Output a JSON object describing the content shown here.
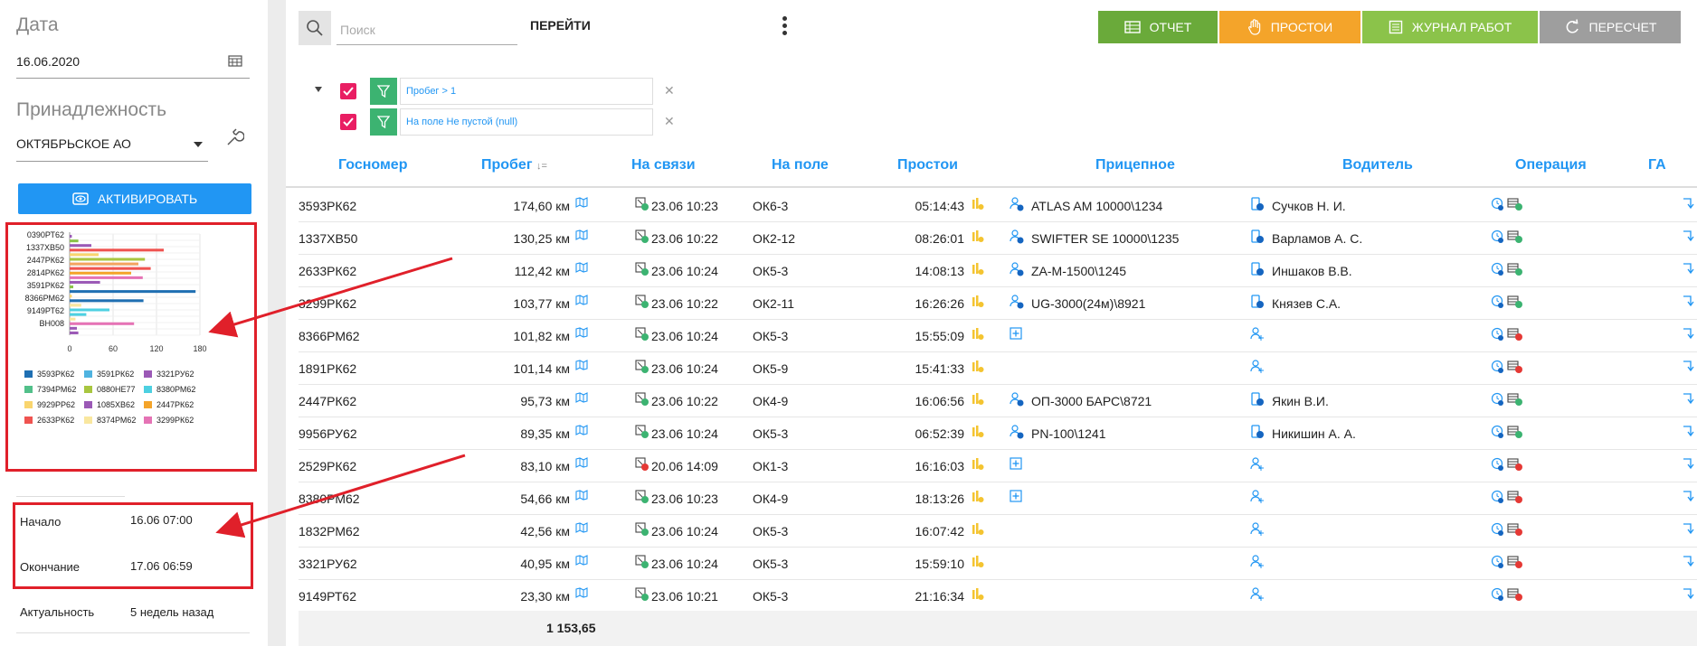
{
  "sidebar": {
    "date_label": "Дата",
    "date_value": "16.06.2020",
    "owner_label": "Принадлежность",
    "owner_value": "ОКТЯБРЬСКОЕ АО",
    "activate_label": "АКТИВИРОВАТЬ",
    "info": [
      {
        "label": "Начало",
        "value": "16.06 07:00"
      },
      {
        "label": "Окончание",
        "value": "17.06 06:59"
      },
      {
        "label": "Актуальность",
        "value": "5 недель назад"
      }
    ]
  },
  "toolbar": {
    "search_placeholder": "Поиск",
    "go_label": "ПЕРЕЙТИ",
    "buttons": [
      {
        "label": "ОТЧЕТ",
        "color": "#6aaa3a"
      },
      {
        "label": "ПРОСТОИ",
        "color": "#f4a42a"
      },
      {
        "label": "ЖУРНАЛ РАБОТ",
        "color": "#8bc34a"
      },
      {
        "label": "ПЕРЕСЧЕТ",
        "color": "#9e9e9e"
      }
    ]
  },
  "filters": [
    {
      "text": "Пробег > 1"
    },
    {
      "text": "На поле Не пустой (null)"
    }
  ],
  "table": {
    "columns": [
      "Госномер",
      "Пробег",
      "На связи",
      "На поле",
      "Простои",
      "Прицепное",
      "Водитель",
      "Операция",
      "ГА"
    ],
    "rows": [
      {
        "plate": "3593РК62",
        "mileage": "174,60 км",
        "online": "23.06 10:23",
        "field": "ОК6-3",
        "idle": "05:14:43",
        "trailer": "ATLAS AM 10000\\1234",
        "driver": "Сучков Н. И.",
        "online_ok": true,
        "op_ok": true
      },
      {
        "plate": "1337ХВ50",
        "mileage": "130,25 км",
        "online": "23.06 10:22",
        "field": "ОК2-12",
        "idle": "08:26:01",
        "trailer": "SWIFTER SE 10000\\1235",
        "driver": "Варламов А. С.",
        "online_ok": true,
        "op_ok": true
      },
      {
        "plate": "2633РК62",
        "mileage": "112,42 км",
        "online": "23.06 10:24",
        "field": "ОК5-3",
        "idle": "14:08:13",
        "trailer": "ZA-M-1500\\1245",
        "driver": "Иншаков В.В.",
        "online_ok": true,
        "op_ok": true
      },
      {
        "plate": "3299РК62",
        "mileage": "103,77 км",
        "online": "23.06 10:22",
        "field": "ОК2-11",
        "idle": "16:26:26",
        "trailer": "UG-3000(24м)\\8921",
        "driver": "Князев С.А.",
        "online_ok": true,
        "op_ok": true
      },
      {
        "plate": "8366РМ62",
        "mileage": "101,82 км",
        "online": "23.06 10:24",
        "field": "ОК5-3",
        "idle": "15:55:09",
        "trailer": "",
        "driver": "",
        "online_ok": true,
        "op_ok": false
      },
      {
        "plate": "1891РК62",
        "mileage": "101,14 км",
        "online": "23.06 10:24",
        "field": "ОК5-9",
        "idle": "15:41:33",
        "trailer": "",
        "driver": "",
        "online_ok": true,
        "op_ok": false
      },
      {
        "plate": "2447РК62",
        "mileage": "95,73 км",
        "online": "23.06 10:22",
        "field": "ОК4-9",
        "idle": "16:06:56",
        "trailer": "ОП-3000 БАРС\\8721",
        "driver": "Якин В.И.",
        "online_ok": true,
        "op_ok": true
      },
      {
        "plate": "9956РУ62",
        "mileage": "89,35 км",
        "online": "23.06 10:24",
        "field": "ОК5-3",
        "idle": "06:52:39",
        "trailer": "PN-100\\1241",
        "driver": "Никишин А. А.",
        "online_ok": true,
        "op_ok": true
      },
      {
        "plate": "2529РК62",
        "mileage": "83,10 км",
        "online": "20.06 14:09",
        "field": "ОК1-3",
        "idle": "16:16:03",
        "trailer": "",
        "driver": "",
        "online_ok": false,
        "op_ok": false
      },
      {
        "plate": "8380РМ62",
        "mileage": "54,66 км",
        "online": "23.06 10:23",
        "field": "ОК4-9",
        "idle": "18:13:26",
        "trailer": "",
        "driver": "",
        "online_ok": true,
        "op_ok": false
      },
      {
        "plate": "1832РМ62",
        "mileage": "42,56 км",
        "online": "23.06 10:24",
        "field": "ОК5-3",
        "idle": "16:07:42",
        "trailer": "",
        "driver": "",
        "online_ok": true,
        "op_ok": false
      },
      {
        "plate": "3321РУ62",
        "mileage": "40,95 км",
        "online": "23.06 10:24",
        "field": "ОК5-3",
        "idle": "15:59:10",
        "trailer": "",
        "driver": "",
        "online_ok": true,
        "op_ok": false
      },
      {
        "plate": "9149РТ62",
        "mileage": "23,30 км",
        "online": "23.06 10:21",
        "field": "ОК5-3",
        "idle": "21:16:34",
        "trailer": "",
        "driver": "",
        "online_ok": true,
        "op_ok": false
      }
    ],
    "total": "1 153,65"
  },
  "chart_data": {
    "type": "bar",
    "orientation": "horizontal",
    "category_labels": [
      "0390РТ62",
      "1337ХВ50",
      "2447РК62",
      "2814РК62",
      "3591РК62",
      "8366РМ62",
      "9149РТ62",
      "ВН008"
    ],
    "xticks": [
      0,
      60,
      120,
      180
    ],
    "xlim": [
      0,
      180
    ],
    "bars": [
      {
        "value": 3,
        "color": "#9b59b6"
      },
      {
        "value": 12,
        "color": "#8bc34a"
      },
      {
        "value": 30,
        "color": "#9b59b6"
      },
      {
        "value": 130,
        "color": "#ef5350"
      },
      {
        "value": 40,
        "color": "#f9d56e"
      },
      {
        "value": 104,
        "color": "#a8c640"
      },
      {
        "value": 95,
        "color": "#f4a460"
      },
      {
        "value": 112,
        "color": "#ef5350"
      },
      {
        "value": 85,
        "color": "#f4a42a"
      },
      {
        "value": 101,
        "color": "#e573b5"
      },
      {
        "value": 42,
        "color": "#9b59b6"
      },
      {
        "value": 5,
        "color": "#8bc34a"
      },
      {
        "value": 174,
        "color": "#1f6fb2"
      },
      {
        "value": 3,
        "color": "#f9d56e"
      },
      {
        "value": 102,
        "color": "#1f6fb2"
      },
      {
        "value": 16,
        "color": "#f9e79f"
      },
      {
        "value": 55,
        "color": "#4dd0e1"
      },
      {
        "value": 23,
        "color": "#4dd0e1"
      },
      {
        "value": 8,
        "color": "#f9e79f"
      },
      {
        "value": 89,
        "color": "#e573b5"
      },
      {
        "value": 10,
        "color": "#9b59b6"
      },
      {
        "value": 12,
        "color": "#9b59b6"
      }
    ],
    "legend": [
      {
        "name": "3593РК62",
        "color": "#1f6fb2"
      },
      {
        "name": "3591РК62",
        "color": "#4fb3e0"
      },
      {
        "name": "3321РУ62",
        "color": "#9b59b6"
      },
      {
        "name": "7394РМ62",
        "color": "#52c08a"
      },
      {
        "name": "0880НЕ77",
        "color": "#a8c640"
      },
      {
        "name": "8380РМ62",
        "color": "#4dd0e1"
      },
      {
        "name": "9929РР62",
        "color": "#f9d56e"
      },
      {
        "name": "1085ХВ62",
        "color": "#9b59b6"
      },
      {
        "name": "2447РК62",
        "color": "#f4a42a"
      },
      {
        "name": "2633РК62",
        "color": "#ef5350"
      },
      {
        "name": "8374РМ62",
        "color": "#f9e79f"
      },
      {
        "name": "3299РК62",
        "color": "#e573b5"
      }
    ]
  }
}
